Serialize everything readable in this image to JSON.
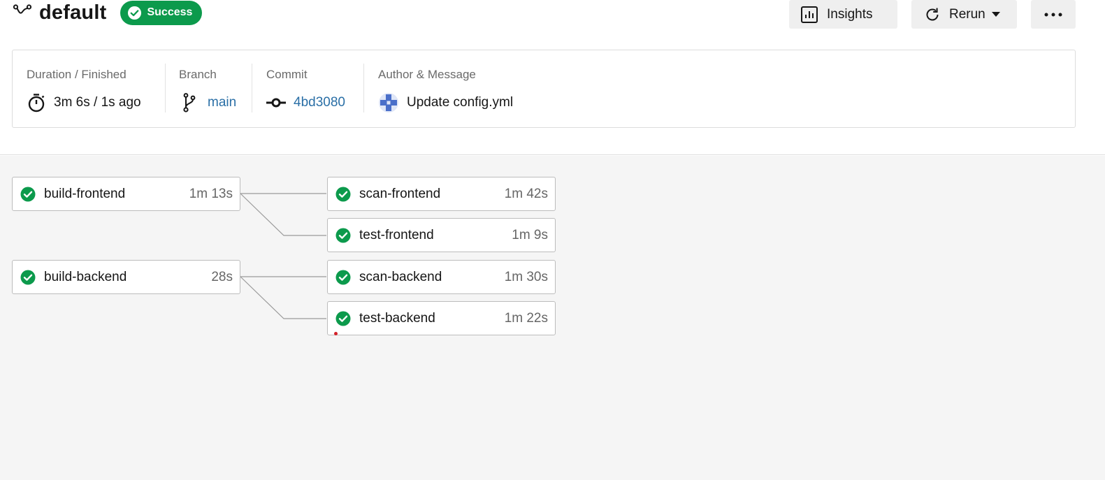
{
  "workflow": {
    "name": "default",
    "status": "Success",
    "icon": "workflow-icon",
    "status_color": "#0c9a4c"
  },
  "actions": {
    "insights_label": "Insights",
    "rerun_label": "Rerun",
    "more_icon": "more-horizontal-icon"
  },
  "info": {
    "duration_label": "Duration / Finished",
    "duration_value": "3m 6s / 1s ago",
    "branch_label": "Branch",
    "branch_value": "main",
    "commit_label": "Commit",
    "commit_value": "4bd3080",
    "author_label": "Author & Message",
    "message_value": "Update config.yml",
    "link_color": "#2a6fa6"
  },
  "jobs": {
    "build_frontend": {
      "name": "build-frontend",
      "duration": "1m 13s"
    },
    "scan_frontend": {
      "name": "scan-frontend",
      "duration": "1m 42s"
    },
    "test_frontend": {
      "name": "test-frontend",
      "duration": "1m 9s"
    },
    "build_backend": {
      "name": "build-backend",
      "duration": "28s"
    },
    "scan_backend": {
      "name": "scan-backend",
      "duration": "1m 30s"
    },
    "test_backend": {
      "name": "test-backend",
      "duration": "1m 22s"
    }
  }
}
